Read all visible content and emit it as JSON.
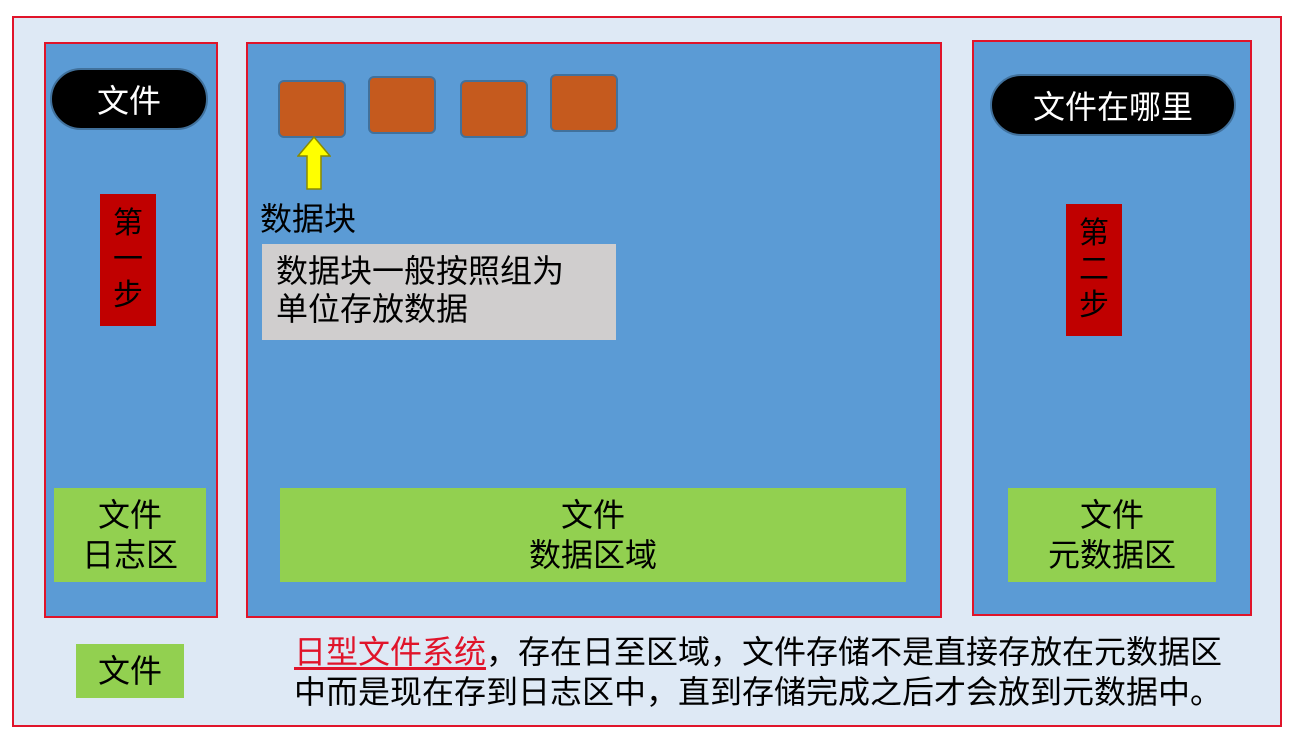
{
  "left_panel": {
    "title": "文件",
    "step": "第一步",
    "region_line1": "文件",
    "region_line2": "日志区"
  },
  "middle_panel": {
    "block_label": "数据块",
    "note_line1": "数据块一般按照组为",
    "note_line2": "单位存放数据",
    "region_line1": "文件",
    "region_line2": "数据区域"
  },
  "right_panel": {
    "title": "文件在哪里",
    "step": "第二步",
    "region_line1": "文件",
    "region_line2": "元数据区"
  },
  "bottom": {
    "file_label": "文件",
    "term": "日型文件系统",
    "desc_line1_rest": "，存在日至区域，文件存储不是直接存放在元数据区",
    "desc_line2": "中而是现在存到日志区中，直到存储完成之后才会放到元数据中。"
  },
  "colors": {
    "border": "#e0142a",
    "panel": "#5b9bd5",
    "region": "#92d050",
    "step": "#c00000",
    "block": "#c55a1e",
    "arrow": "#ffff00",
    "note": "#d0cece"
  }
}
